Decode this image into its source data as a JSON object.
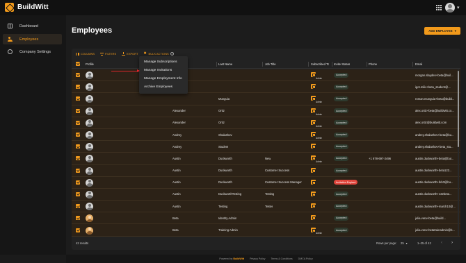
{
  "app": {
    "name": "BuildWitt"
  },
  "sidebar": {
    "items": [
      {
        "label": "Dashboard",
        "icon": "dashboard-icon"
      },
      {
        "label": "Employees",
        "icon": "users-icon",
        "active": true
      },
      {
        "label": "Company Settings",
        "icon": "gear-icon"
      }
    ]
  },
  "main": {
    "title": "Employees",
    "add_button": "ADD EMPLOYEE",
    "toolbar": {
      "columns": "COLUMNS",
      "filters": "FILTERS",
      "export": "EXPORT",
      "bulk_actions": "BULK ACTIONS"
    },
    "columns": {
      "profile": "Profile",
      "last_name": "Last Name",
      "job_title": "Job Title",
      "subscribed_to": "Subscribed To",
      "invite_status": "Invite Status",
      "phone": "Phone",
      "email": "Email"
    },
    "rows": [
      {
        "first": "",
        "last": "",
        "job": "",
        "admin": "Admin",
        "status": "Accepted",
        "phone": "",
        "email": "morgan.slayden+beta@buil..."
      },
      {
        "first": "",
        "last": "",
        "job": "",
        "admin": "",
        "status": "Accepted",
        "phone": "",
        "email": "igor.milic+beta_student@..."
      },
      {
        "first": "",
        "last": "Munguia",
        "job": "",
        "admin": "Admin",
        "status": "Accepted",
        "phone": "",
        "email": "roman.munguia+beta@build..."
      },
      {
        "first": "Alexander",
        "last": "Ortiz",
        "job": "",
        "admin": "Admin",
        "status": "Accepted",
        "phone": "",
        "email": "alex.ortiz+beta@buildwitt.co..."
      },
      {
        "first": "Alexander",
        "last": "Ortiz",
        "job": "",
        "admin": "Admin",
        "status": "Accepted",
        "phone": "",
        "email": "alex.ortiz@buildwitt.com"
      },
      {
        "first": "Andrey",
        "last": "Shalashov",
        "job": "",
        "admin": "Admin",
        "status": "Accepted",
        "phone": "",
        "email": "andrey.shalashov+beta@bu..."
      },
      {
        "first": "Andrey",
        "last": "Student",
        "job": "",
        "admin": "",
        "status": "Accepted",
        "phone": "",
        "email": "andrey.shalashov+beta_stu..."
      },
      {
        "first": "Austin",
        "last": "Duckworth",
        "job": "New",
        "admin": "Admin",
        "status": "Accepted",
        "phone": "+1 678-697-2496",
        "email": "austin.duckworth+beta@bui..."
      },
      {
        "first": "Austin",
        "last": "Duckworth",
        "job": "Customer Success",
        "admin": "",
        "status": "Accepted",
        "phone": "",
        "email": "austin.duckworth+beta122..."
      },
      {
        "first": "Austin",
        "last": "Duckworth",
        "job": "Customer Success Manager",
        "admin": "",
        "status": "Invitation Expired",
        "phone": "",
        "email": "austin.duckworth+feb3@bu..."
      },
      {
        "first": "Austin",
        "last": "DuckworthTesting",
        "job": "Testing",
        "admin": "",
        "status": "Accepted",
        "phone": "",
        "email": "austin.duckworth+122beta..."
      },
      {
        "first": "Austin",
        "last": "Testing",
        "job": "Tester",
        "admin": "",
        "status": "Accepted",
        "phone": "",
        "email": "austin.duckworth+march10@..."
      },
      {
        "first": "Beta",
        "last": "Identity Admin",
        "job": "",
        "admin": "",
        "status": "Accepted",
        "phone": "",
        "email": "julia.vera+beta@build..."
      },
      {
        "first": "Beta",
        "last": "Training Admin",
        "job": "",
        "admin": "Admin",
        "status": "Accepted",
        "phone": "",
        "email": "julia.vera+betatrainadmin@b..."
      }
    ],
    "footer": {
      "results": "42 results",
      "rows_per_page_label": "Rows per page:",
      "rows_per_page_value": "25",
      "range": "1–25 of 42"
    }
  },
  "bulk_menu": {
    "items": [
      "Manage Subscriptions",
      "Manage Invitations",
      "Manage Employment Info",
      "Archive Employees"
    ]
  },
  "bottom": {
    "powered_by": "Powered by",
    "brand": "BuildWitt",
    "privacy": "Privacy Policy",
    "terms": "Terms & Conditions",
    "dmca": "DMCA Policy"
  },
  "colors": {
    "accent": "#f29a1b",
    "row_bg": "#2c2217",
    "expired": "#e0463d",
    "arrow": "#e0262b"
  }
}
